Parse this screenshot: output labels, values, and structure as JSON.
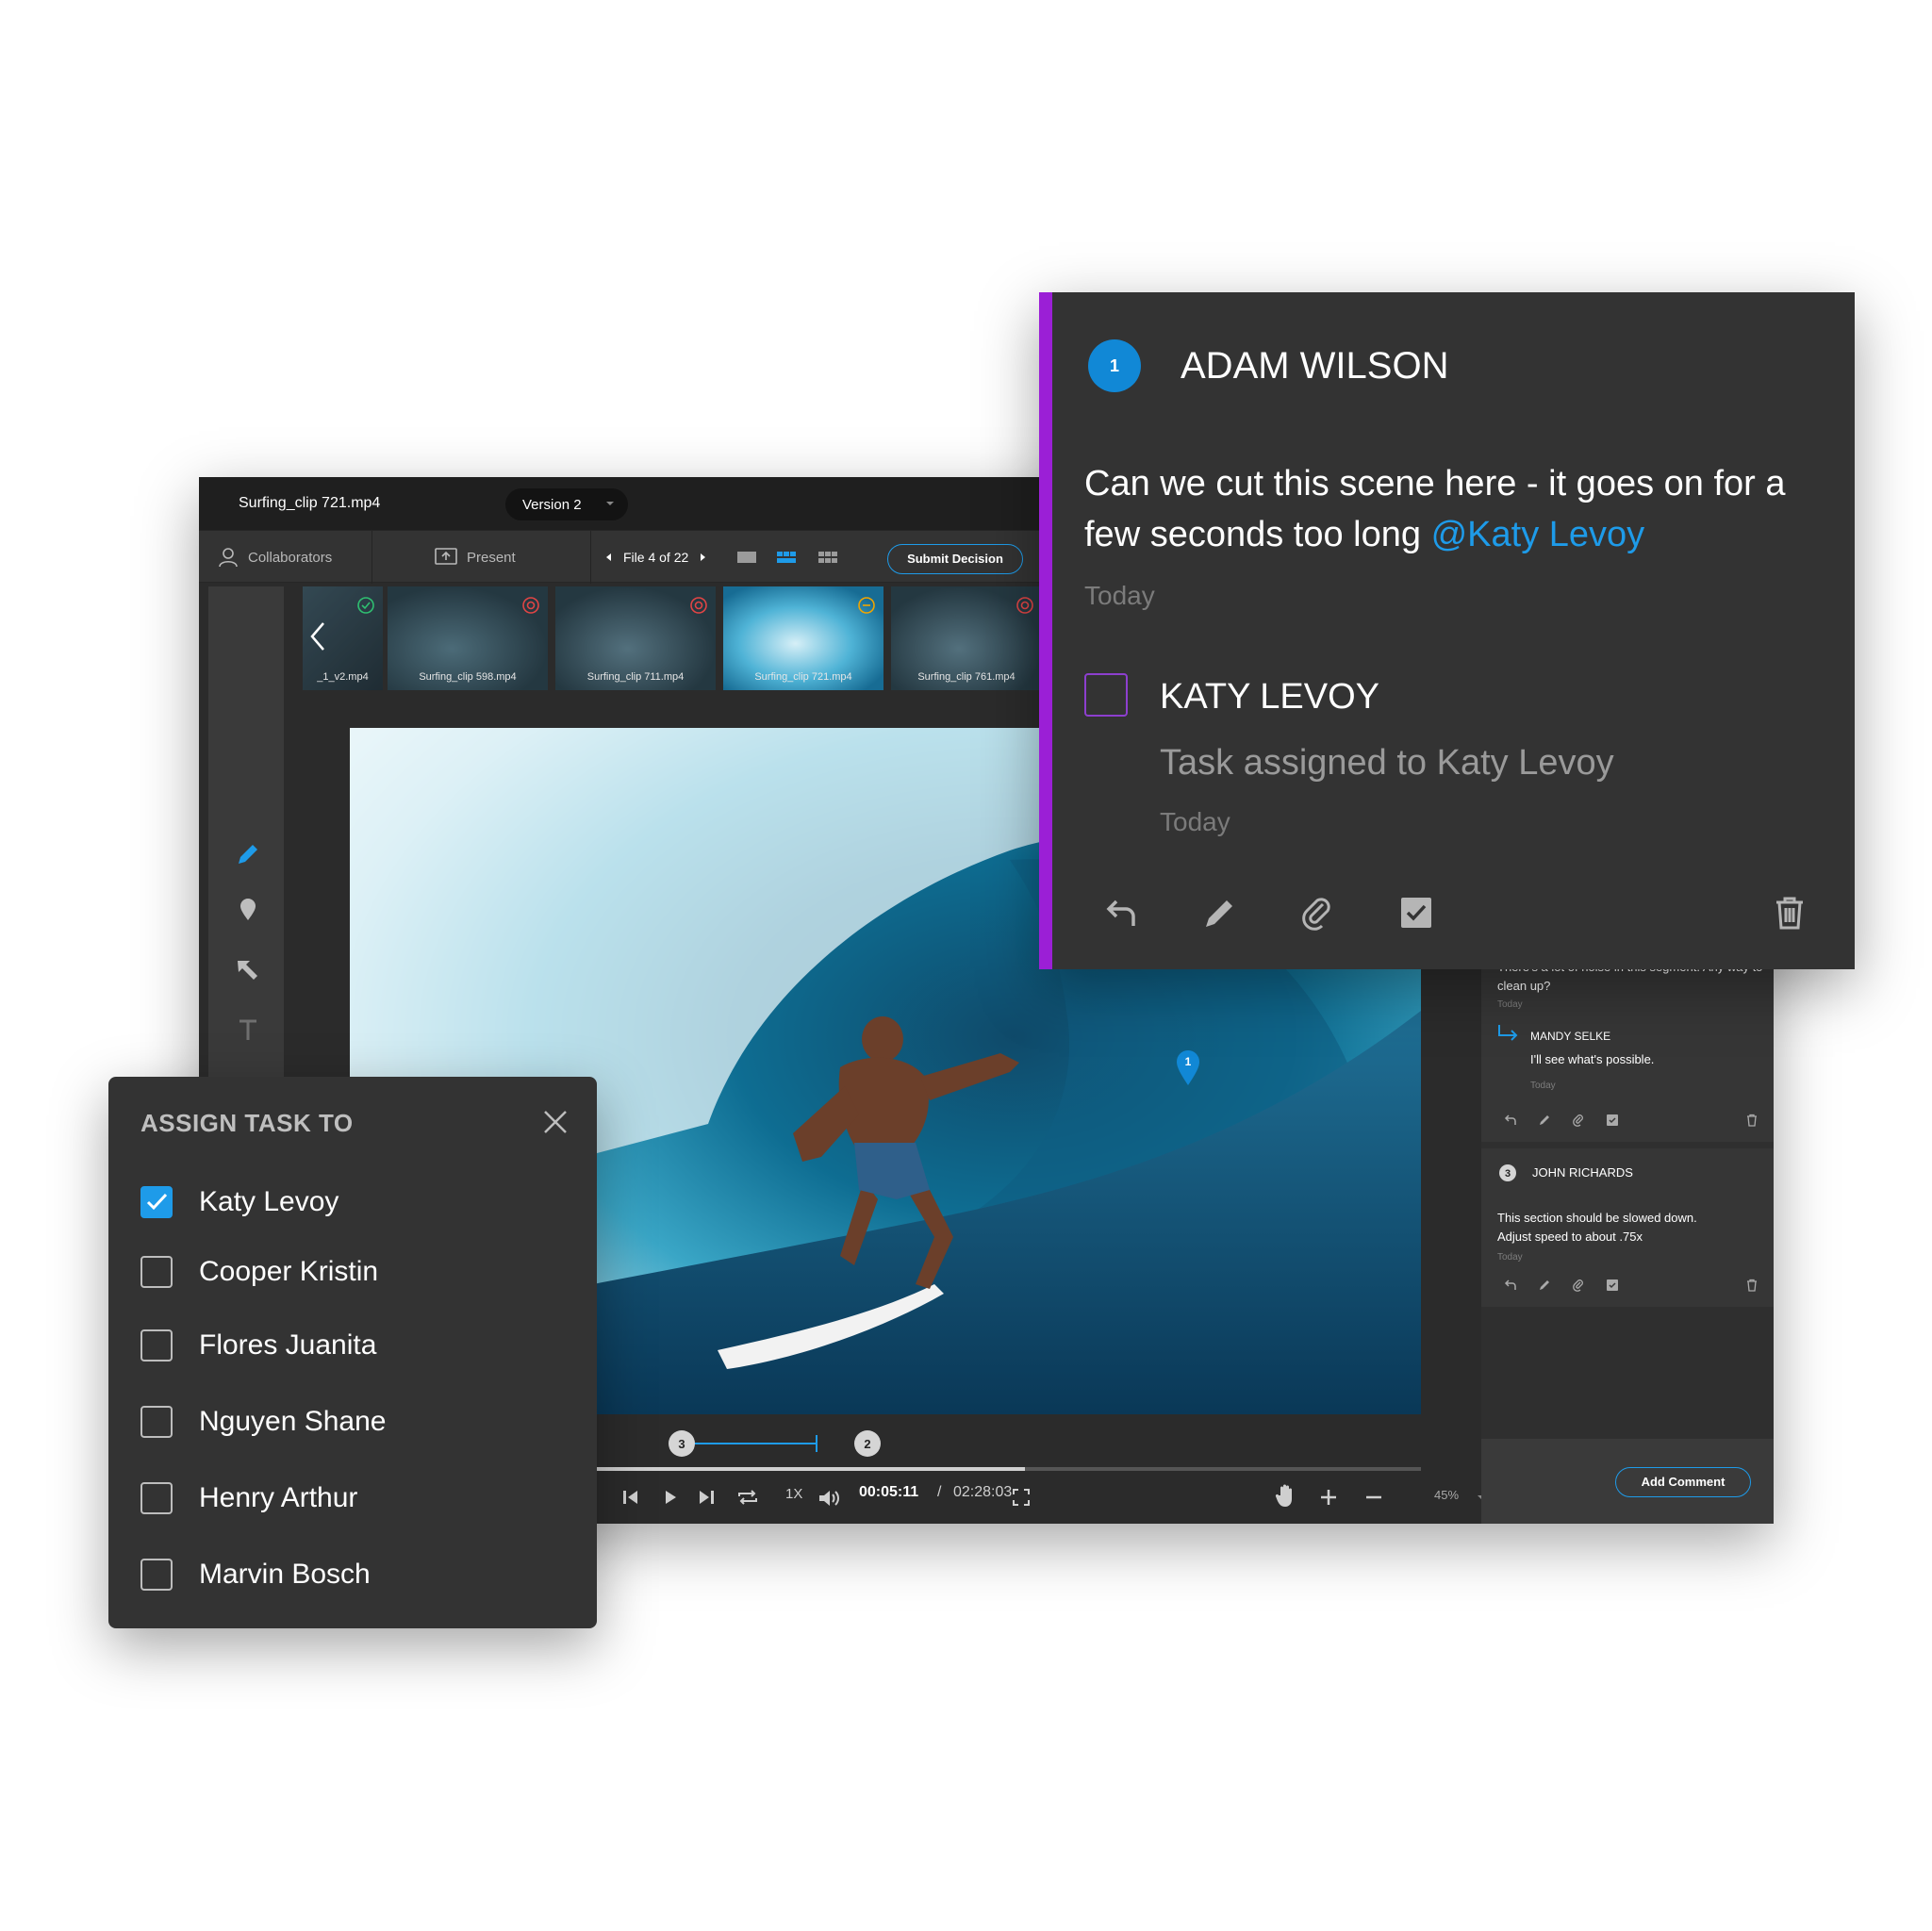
{
  "app": {
    "file_title": "Surfing_clip 721.mp4",
    "version": "Version 2",
    "toolbar": {
      "collaborators": "Collaborators",
      "present": "Present",
      "file_nav": "File 4 of 22",
      "submit": "Submit Decision"
    },
    "thumbnails": [
      {
        "label": "_1_v2.mp4",
        "status": "approved"
      },
      {
        "label": "Surfing_clip 598.mp4",
        "status": "rejected"
      },
      {
        "label": "Surfing_clip 711.mp4",
        "status": "rejected"
      },
      {
        "label": "Surfing_clip 721.mp4",
        "status": "pending"
      },
      {
        "label": "Surfing_clip 761.mp4",
        "status": "rejected"
      }
    ],
    "markers": {
      "pin": "1",
      "range_start": "3",
      "range_end": "2"
    },
    "playback": {
      "current": "00:05:11",
      "separator": "/",
      "total": "02:28:03",
      "speed": "1X",
      "zoom": "45%",
      "progress_fraction": 0.63
    },
    "comments": [
      {
        "text": "There's a lot of noise in this segment. Any way to clean up?",
        "date": "Today",
        "reply": {
          "author": "MANDY SELKE",
          "text": "I'll see what's possible.",
          "date": "Today"
        }
      },
      {
        "number": "3",
        "author": "JOHN RICHARDS",
        "text_line1": "This section should be slowed down.",
        "text_line2": "Adjust speed to about .75x",
        "date": "Today"
      }
    ],
    "add_comment": "Add Comment"
  },
  "popup": {
    "number": "1",
    "author": "ADAM WILSON",
    "comment": "Can we cut this scene here - it goes on for a few seconds too long ",
    "mention": "@Katy Levoy",
    "date": "Today",
    "task": {
      "assignee": "KATY LEVOY",
      "description": "Task assigned to Katy Levoy",
      "date": "Today"
    }
  },
  "assign": {
    "title": "ASSIGN TASK TO",
    "people": [
      {
        "name": "Katy Levoy",
        "checked": true
      },
      {
        "name": "Cooper Kristin",
        "checked": false
      },
      {
        "name": "Flores Juanita",
        "checked": false
      },
      {
        "name": "Nguyen Shane",
        "checked": false
      },
      {
        "name": "Henry Arthur",
        "checked": false
      },
      {
        "name": "Marvin Bosch",
        "checked": false
      }
    ]
  },
  "colors": {
    "accent_blue": "#1e9be9",
    "accent_purple": "#9b1fd6",
    "panel": "#333333"
  }
}
